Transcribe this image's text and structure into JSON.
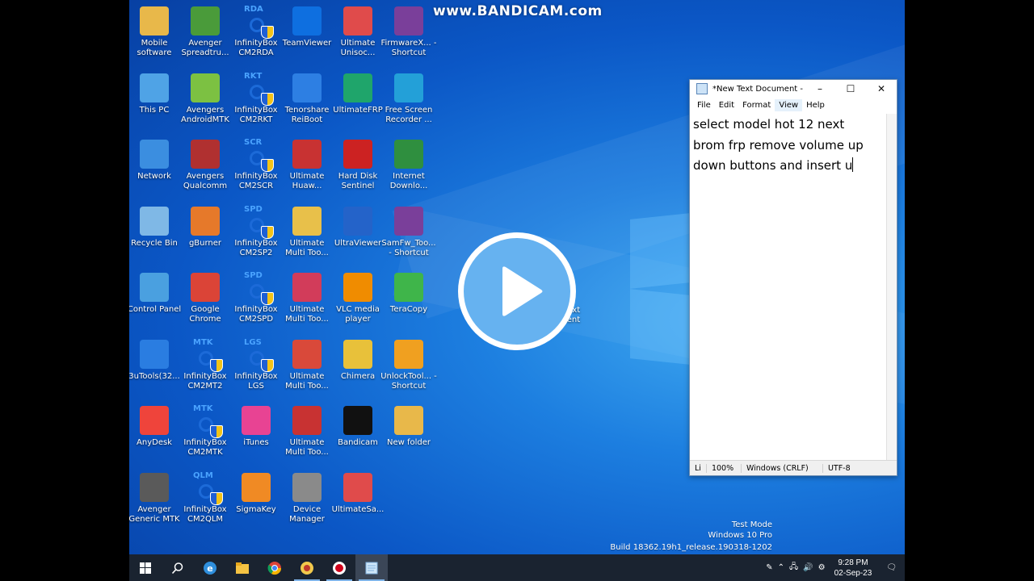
{
  "watermark": "www.BANDICAM.com",
  "icons": [
    {
      "label": "Mobile software",
      "icon": "folder-icon",
      "color": "#e8b84a",
      "col": 0,
      "row": 0
    },
    {
      "label": "Avenger Spreadtru...",
      "icon": "android-avenger-icon",
      "color": "#4a9b3a",
      "col": 1,
      "row": 0
    },
    {
      "label": "InfinityBox CM2RDA",
      "icon": "infinitybox-icon",
      "color": "#1b6fd8",
      "col": 2,
      "row": 0,
      "tag": "RDA",
      "shield": true
    },
    {
      "label": "TeamViewer",
      "icon": "teamviewer-icon",
      "color": "#0e6fe0",
      "col": 3,
      "row": 0
    },
    {
      "label": "Ultimate Unisoc...",
      "icon": "ultimate-icon",
      "color": "#e04b4b",
      "col": 4,
      "row": 0
    },
    {
      "label": "FirmwareX... - Shortcut",
      "icon": "winrar-icon",
      "color": "#7a3f9a",
      "col": 5,
      "row": 0
    },
    {
      "label": "This PC",
      "icon": "pc-icon",
      "color": "#4fa3e6",
      "col": 0,
      "row": 1
    },
    {
      "label": "Avengers AndroidMTK",
      "icon": "android-icon",
      "color": "#7cc142",
      "col": 1,
      "row": 1
    },
    {
      "label": "InfinityBox CM2RKT",
      "icon": "infinitybox-icon",
      "color": "#1b6fd8",
      "col": 2,
      "row": 1,
      "tag": "RKT",
      "shield": true
    },
    {
      "label": "Tenorshare ReiBoot",
      "icon": "reiboot-icon",
      "color": "#2d7fe3",
      "col": 3,
      "row": 1
    },
    {
      "label": "UltimateFRP",
      "icon": "frp-icon",
      "color": "#1fa56b",
      "col": 4,
      "row": 1
    },
    {
      "label": "Free Screen Recorder ...",
      "icon": "recorder-icon",
      "color": "#23a0d8",
      "col": 5,
      "row": 1
    },
    {
      "label": "Network",
      "icon": "network-icon",
      "color": "#3b8ee0",
      "col": 0,
      "row": 2
    },
    {
      "label": "Avengers Qualcomm",
      "icon": "avengers-qualcomm-icon",
      "color": "#b03030",
      "col": 1,
      "row": 2
    },
    {
      "label": "InfinityBox CM2SCR",
      "icon": "infinitybox-icon",
      "color": "#1b6fd8",
      "col": 2,
      "row": 2,
      "tag": "SCR",
      "shield": true
    },
    {
      "label": "Ultimate Huaw...",
      "icon": "ultimate-icon",
      "color": "#c83232",
      "col": 3,
      "row": 2
    },
    {
      "label": "Hard Disk Sentinel",
      "icon": "harddisk-icon",
      "color": "#c22",
      "col": 4,
      "row": 2
    },
    {
      "label": "Internet Downlo...",
      "icon": "idm-icon",
      "color": "#2f8f3f",
      "col": 5,
      "row": 2
    },
    {
      "label": "Recycle Bin",
      "icon": "recycle-bin-icon",
      "color": "#7fb8e6",
      "col": 0,
      "row": 3
    },
    {
      "label": "gBurner",
      "icon": "gburner-icon",
      "color": "#e6792a",
      "col": 1,
      "row": 3
    },
    {
      "label": "InfinityBox CM2SP2",
      "icon": "infinitybox-icon",
      "color": "#1b6fd8",
      "col": 2,
      "row": 3,
      "tag": "SPD",
      "shield": true
    },
    {
      "label": "Ultimate Multi Too...",
      "icon": "ultimate-icon",
      "color": "#e8c04a",
      "col": 3,
      "row": 3
    },
    {
      "label": "UltraViewer",
      "icon": "ultraviewer-icon",
      "color": "#2463c9",
      "col": 4,
      "row": 3
    },
    {
      "label": "SamFw_Too... - Shortcut",
      "icon": "winrar-icon",
      "color": "#7a3f9a",
      "col": 5,
      "row": 3
    },
    {
      "label": "Control Panel",
      "icon": "control-panel-icon",
      "color": "#4aa0e0",
      "col": 0,
      "row": 4
    },
    {
      "label": "Google Chrome",
      "icon": "chrome-icon",
      "color": "#db4437",
      "col": 1,
      "row": 4
    },
    {
      "label": "InfinityBox CM2SPD",
      "icon": "infinitybox-icon",
      "color": "#1b6fd8",
      "col": 2,
      "row": 4,
      "tag": "SPD",
      "shield": true
    },
    {
      "label": "Ultimate Multi Too...",
      "icon": "ultimate-icon",
      "color": "#d23c5a",
      "col": 3,
      "row": 4
    },
    {
      "label": "VLC media player",
      "icon": "vlc-icon",
      "color": "#f08c00",
      "col": 4,
      "row": 4
    },
    {
      "label": "TeraCopy",
      "icon": "teracopy-icon",
      "color": "#3fb54a",
      "col": 5,
      "row": 4
    },
    {
      "label": "3uTools(32...",
      "icon": "3utools-icon",
      "color": "#2a7de1",
      "col": 0,
      "row": 5
    },
    {
      "label": "InfinityBox CM2MT2",
      "icon": "infinitybox-icon",
      "color": "#1b6fd8",
      "col": 1,
      "row": 5,
      "tag": "MTK",
      "shield": true
    },
    {
      "label": "InfinityBox LGS",
      "icon": "infinitybox-icon",
      "color": "#1b6fd8",
      "col": 2,
      "row": 5,
      "tag": "LGS",
      "shield": true
    },
    {
      "label": "Ultimate Multi Too...",
      "icon": "ultimate-icon",
      "color": "#d9493a",
      "col": 3,
      "row": 5
    },
    {
      "label": "Chimera",
      "icon": "chimera-icon",
      "color": "#e8c13a",
      "col": 4,
      "row": 5
    },
    {
      "label": "UnlockTool... - Shortcut",
      "icon": "unlocktool-icon",
      "color": "#f0a020",
      "col": 5,
      "row": 5
    },
    {
      "label": "AnyDesk",
      "icon": "anydesk-icon",
      "color": "#ef443b",
      "col": 0,
      "row": 6
    },
    {
      "label": "InfinityBox CM2MTK",
      "icon": "infinitybox-icon",
      "color": "#1b6fd8",
      "col": 1,
      "row": 6,
      "tag": "MTK",
      "shield": true
    },
    {
      "label": "iTunes",
      "icon": "itunes-icon",
      "color": "#e84393",
      "col": 2,
      "row": 6
    },
    {
      "label": "Ultimate Multi Too...",
      "icon": "ultimate-icon",
      "color": "#c83232",
      "col": 3,
      "row": 6
    },
    {
      "label": "Bandicam",
      "icon": "bandicam-icon",
      "color": "#111",
      "col": 4,
      "row": 6
    },
    {
      "label": "New folder",
      "icon": "folder-icon",
      "color": "#e8b84a",
      "col": 5,
      "row": 6
    },
    {
      "label": "Avenger Generic MTK",
      "icon": "phone-icon",
      "color": "#5a5a5a",
      "col": 0,
      "row": 7
    },
    {
      "label": "InfinityBox CM2QLM",
      "icon": "infinitybox-icon",
      "color": "#1b6fd8",
      "col": 1,
      "row": 7,
      "tag": "QLM",
      "shield": true
    },
    {
      "label": "SigmaKey",
      "icon": "sigmakey-icon",
      "color": "#f08a24",
      "col": 2,
      "row": 7
    },
    {
      "label": "Device Manager",
      "icon": "device-manager-icon",
      "color": "#8a8a8a",
      "col": 3,
      "row": 7
    },
    {
      "label": "UltimateSa...",
      "icon": "ultimate-icon",
      "color": "#e04b4b",
      "col": 4,
      "row": 7
    }
  ],
  "hidden_icon_text": {
    "line1": "xt",
    "line2": "ment"
  },
  "notepad": {
    "title": "*New Text Document - ...",
    "menu": [
      "File",
      "Edit",
      "Format",
      "View",
      "Help"
    ],
    "active_menu": "View",
    "lines": [
      "select model hot 12  next",
      "brom frp remove volume up",
      "down buttons and insert u"
    ],
    "status": {
      "pos": "Li",
      "zoom": "100%",
      "eol": "Windows (CRLF)",
      "encoding": "UTF-8"
    }
  },
  "watermark_text": {
    "line1": "Test Mode",
    "line2": "Windows 10 Pro",
    "line3": "Build 18362.19h1_release.190318-1202"
  },
  "taskbar": {
    "items": [
      "start-icon",
      "search-icon",
      "edge-icon",
      "file-explorer-icon",
      "chrome-icon",
      "ultimate-tool-icon",
      "bandicam-icon",
      "notepad-icon"
    ],
    "clock_time": "9:28 PM",
    "clock_date": "02-Sep-23"
  }
}
